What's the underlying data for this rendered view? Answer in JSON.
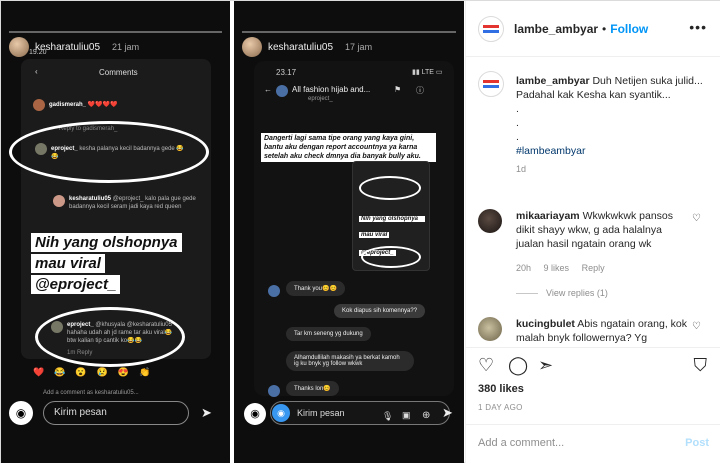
{
  "stories": [
    {
      "user": "kesharatuliu05",
      "time": "21 jam",
      "clock": "19.20",
      "title": "Comments",
      "comments": [
        {
          "user": "gadismerah_",
          "text": "❤️❤️❤️❤️"
        },
        {
          "user": "",
          "text": "Reply to gadismerah_"
        },
        {
          "user": "eproject_",
          "text": "kesha palanya kecil badannya gede 😂😂"
        },
        {
          "user": "kesharatuliu05",
          "text": "@eproject_ kalo pala gue gede badannya kecil seram jadi kaya red queen"
        },
        {
          "user": "eproject_",
          "text": "@khusyala @kesharatuliu05 hahaha udah ah jd rame tar aku viral😂 btw kalian tip cantik ko😂😂"
        },
        {
          "user": "",
          "text": "1m  Reply"
        }
      ],
      "overlay_lines": [
        "Nih yang olshopnya",
        "mau viral",
        "@eproject_"
      ],
      "add_comment": "Add a comment as kesharatuliu05...",
      "input": "Kirim pesan"
    },
    {
      "user": "kesharatuliu05",
      "time": "17 jam",
      "clock": "23.17",
      "chat_title": "All fashion hijab and...",
      "chat_sub": "eproject_",
      "highlight": "Dangerti lagi sama tipe orang yang kaya gini, bantu aku dengan report accountnya ya karna setelah aku check dmnya dia banyak bully aku.",
      "nested_caption": [
        "Nih yang olshopnya",
        "mau viral",
        "@eproject_"
      ],
      "messages": [
        {
          "side": "left",
          "text": "Thank you😊😊"
        },
        {
          "side": "right",
          "text": "Kok diapus sih komennya??"
        },
        {
          "side": "left",
          "text": "Tar km seneng yg dukung"
        },
        {
          "side": "left",
          "text": "Alhamdullilah makasih ya berkat kamoh ig ku bnyk yg follow wkwk"
        },
        {
          "side": "left",
          "text": "Thanks lon😊"
        }
      ],
      "input": "Kirim pesan"
    }
  ],
  "sidebar": {
    "username": "lambe_ambyar",
    "follow_label": "Follow",
    "more_icon": "more-horizontal-icon",
    "caption": {
      "username": "lambe_ambyar",
      "line1": "Duh Netijen suka julid...",
      "line2": "Padahal kak Kesha kan syantik...",
      "dots": [
        ".",
        ".",
        "."
      ],
      "hashtag": "#lambeambyar",
      "age": "1d"
    },
    "comments": [
      {
        "username": "mikaariayam",
        "text": "Wkwkwkwk pansos dikit shayy wkw, g ada halalnya jualan hasil ngatain orang wk",
        "time": "20h",
        "likes": "9 likes",
        "reply": "Reply",
        "view_replies": "View replies (1)"
      },
      {
        "username": "kucingbulet",
        "text": "Abis ngatain orang, kok malah bnyk followernya? Yg"
      }
    ],
    "likes": "380 likes",
    "date": "1 DAY AGO",
    "add_comment_placeholder": "Add a comment...",
    "post_label": "Post"
  }
}
